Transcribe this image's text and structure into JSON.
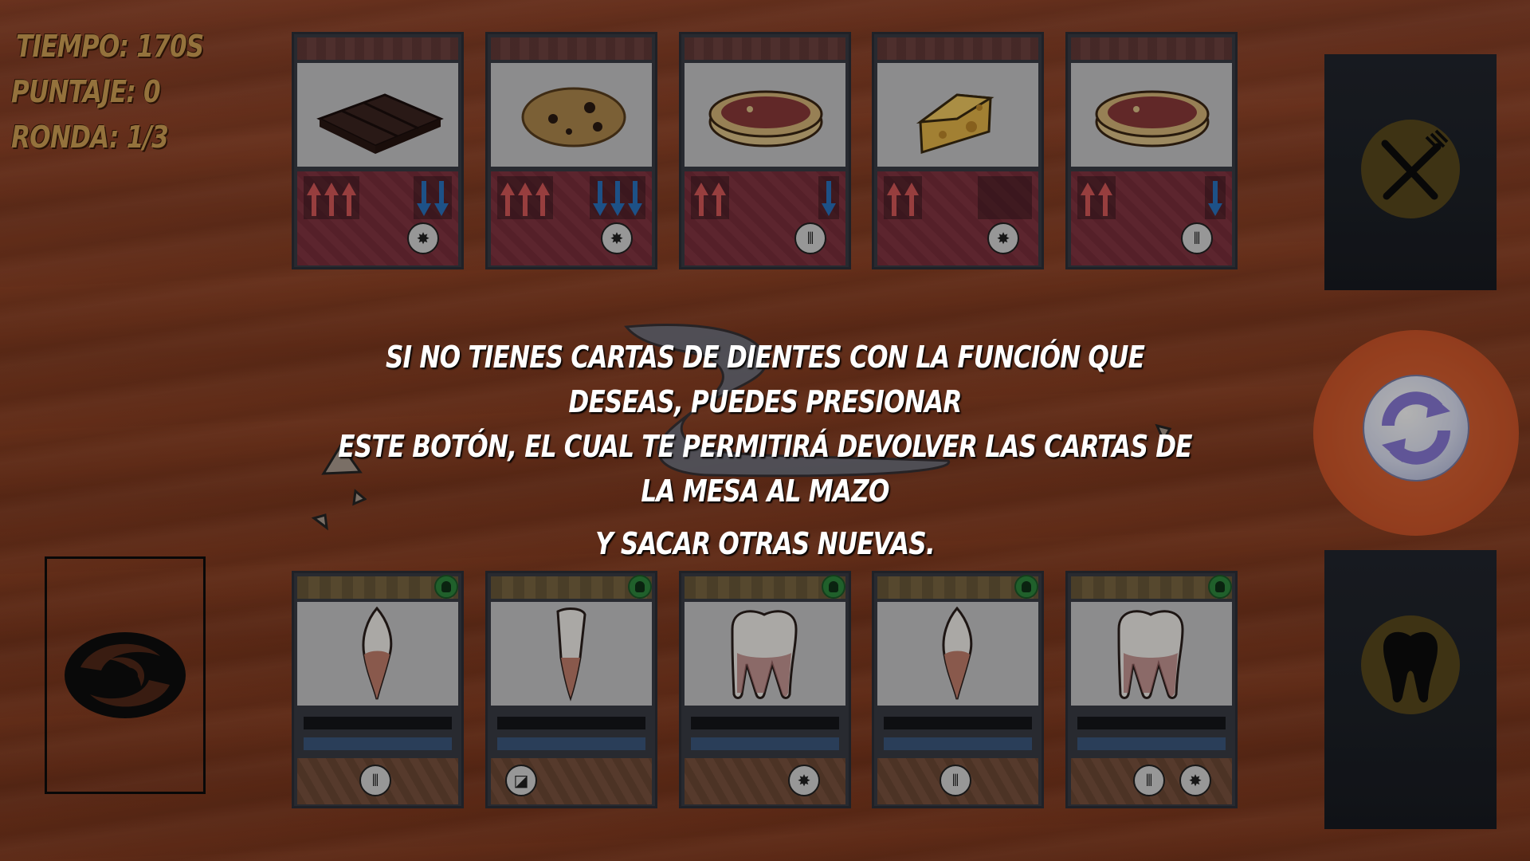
{
  "hud": {
    "time": "TIEMPO: 170S",
    "score": "PUNTAJE: 0",
    "round": "RONDA: 1/3"
  },
  "food_cards": [
    {
      "food": "chocolate bar",
      "up": 3,
      "down": 2,
      "function_icon": "crush-icon"
    },
    {
      "food": "cookie",
      "up": 3,
      "down": 3,
      "function_icon": "crush-icon"
    },
    {
      "food": "steak",
      "up": 2,
      "down": 1,
      "function_icon": "tear-icon"
    },
    {
      "food": "cheese",
      "up": 2,
      "down": 0,
      "function_icon": "crush-icon"
    },
    {
      "food": "steak",
      "up": 2,
      "down": 1,
      "function_icon": "tear-icon"
    }
  ],
  "tooth_cards": [
    {
      "tooth": "canine",
      "functions": [
        "tear-icon"
      ]
    },
    {
      "tooth": "incisor",
      "functions": [
        "cut-icon"
      ]
    },
    {
      "tooth": "molar",
      "functions": [
        "crush-icon"
      ]
    },
    {
      "tooth": "canine",
      "functions": [
        "tear-icon"
      ]
    },
    {
      "tooth": "premolar",
      "functions": [
        "tear-icon",
        "crush-icon"
      ]
    }
  ],
  "panels": {
    "food_icon": "fork-knife-icon",
    "teeth_icon": "tooth-icon",
    "refresh_icon": "refresh-icon",
    "deck_icon": "swirl-icon"
  },
  "tutorial": {
    "line1": "SI NO TIENES CARTAS DE DIENTES CON LA FUNCIÓN QUE DESEAS, PUEDES PRESIONAR",
    "line2": "ESTE BOTÓN, EL CUAL TE PERMITIRÁ DEVOLVER LAS CARTAS DE LA MESA AL MAZO",
    "line3": "Y SACAR OTRAS NUEVAS."
  },
  "colors": {
    "table": "#8a3f22",
    "hud_text": "#d4a457",
    "refresh_ring": "#e36a3a",
    "arrow_up": "#d85a5a",
    "arrow_down": "#2a74c2",
    "tooth_badge": "#2e8a3e"
  }
}
